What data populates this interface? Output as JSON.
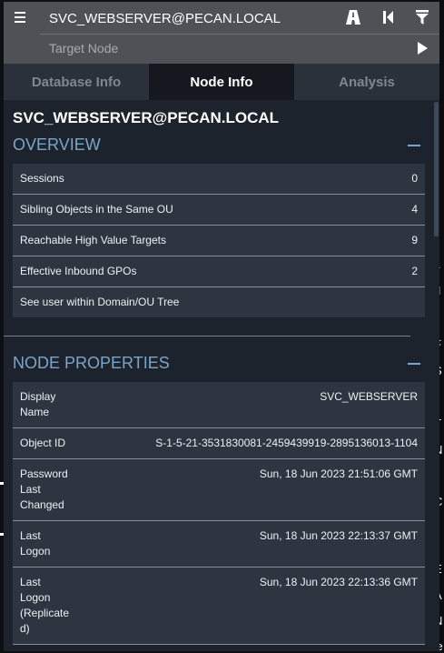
{
  "search": {
    "source_value": "SVC_WEBSERVER@PECAN.LOCAL",
    "target_placeholder": "Target Node"
  },
  "toolbar": {
    "icons": [
      "pathfinding-icon",
      "back-icon",
      "filter-icon",
      "play-icon"
    ]
  },
  "tabs": [
    {
      "label": "Database Info",
      "active": false
    },
    {
      "label": "Node Info",
      "active": true
    },
    {
      "label": "Analysis",
      "active": false
    }
  ],
  "node": {
    "title": "SVC_WEBSERVER@PECAN.LOCAL"
  },
  "overview": {
    "heading": "OVERVIEW",
    "rows": [
      {
        "label": "Sessions",
        "value": "0"
      },
      {
        "label": "Sibling Objects in the Same OU",
        "value": "4"
      },
      {
        "label": "Reachable High Value Targets",
        "value": "9"
      },
      {
        "label": "Effective Inbound GPOs",
        "value": "2"
      },
      {
        "label": "See user within Domain/OU Tree",
        "value": ""
      }
    ]
  },
  "properties": {
    "heading": "NODE PROPERTIES",
    "rows": [
      {
        "label_lines": [
          "Display",
          "Name"
        ],
        "value": "SVC_WEBSERVER"
      },
      {
        "label_lines": [
          "Object ID"
        ],
        "value": "S-1-5-21-3531830081-2459439919-2895136013-1104"
      },
      {
        "label_lines": [
          "Password",
          "Last",
          "Changed"
        ],
        "value": "Sun, 18 Jun 2023 21:51:06 GMT"
      },
      {
        "label_lines": [
          "Last",
          "Logon"
        ],
        "value": "Sun, 18 Jun 2023 22:13:37 GMT"
      },
      {
        "label_lines": [
          "Last",
          "Logon",
          "(Replicate",
          "d)"
        ],
        "value": "Sun, 18 Jun 2023 22:13:36 GMT"
      }
    ]
  },
  "colors": {
    "accent": "#7ba5c8",
    "panel": "#1c232d",
    "row": "#2d3540",
    "searchbar": "#4e5257"
  }
}
